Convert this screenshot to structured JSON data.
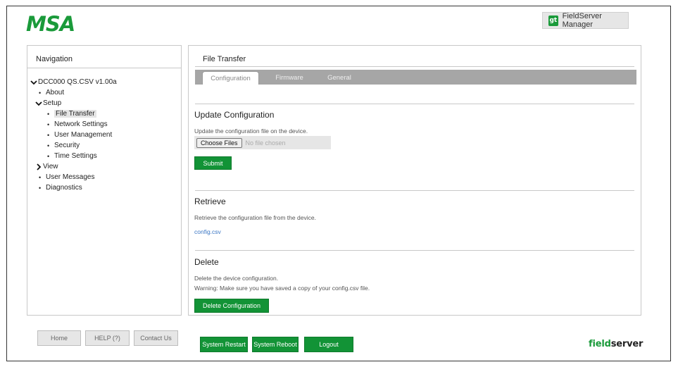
{
  "brand": {
    "logo_text": "MSA",
    "fsm_label": "FieldServer Manager",
    "gt_icon_text": "gt",
    "footer_logo_part1": "field",
    "footer_logo_part2": "server",
    "green": "#129336"
  },
  "nav": {
    "title": "Navigation",
    "root": "DCC000 QS.CSV v1.00a",
    "items": [
      {
        "label": "About"
      },
      {
        "label": "Setup"
      },
      {
        "label": "File Transfer"
      },
      {
        "label": "Network Settings"
      },
      {
        "label": "User Management"
      },
      {
        "label": "Security"
      },
      {
        "label": "Time Settings"
      },
      {
        "label": "View"
      },
      {
        "label": "User Messages"
      },
      {
        "label": "Diagnostics"
      }
    ]
  },
  "main": {
    "title": "File Transfer",
    "tabs": [
      {
        "label": "Configuration"
      },
      {
        "label": "Firmware"
      },
      {
        "label": "General"
      }
    ],
    "update": {
      "heading": "Update Configuration",
      "desc": "Update the configuration file on the device.",
      "choose_label": "Choose Files",
      "no_file": "No file chosen",
      "submit_label": "Submit"
    },
    "retrieve": {
      "heading": "Retrieve",
      "desc": "Retrieve the configuration file from the device.",
      "link": "config.csv"
    },
    "delete": {
      "heading": "Delete",
      "desc": "Delete the device configuration.",
      "warning": "Warning: Make sure you have saved a copy of your config.csv file.",
      "button_label": "Delete Configuration"
    }
  },
  "footer": {
    "home": "Home",
    "help": "HELP (?)",
    "contact": "Contact Us",
    "restart": "System Restart",
    "reboot": "System Reboot",
    "logout": "Logout"
  }
}
